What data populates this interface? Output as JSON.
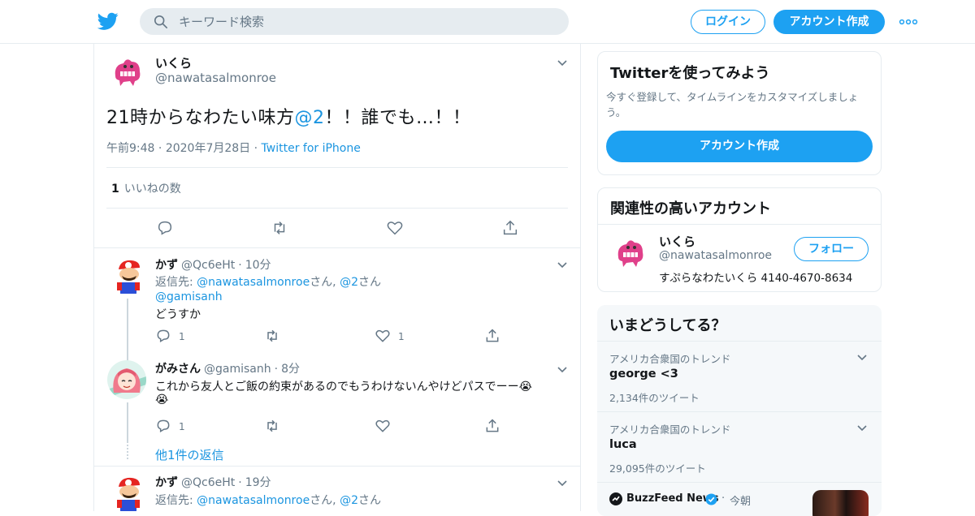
{
  "header": {
    "search_placeholder": "キーワード検索",
    "login_label": "ログイン",
    "signup_label": "アカウント作成"
  },
  "tweet": {
    "name": "いくら",
    "handle": "@nawatasalmonroe",
    "text_before": "21時からなわたい味方",
    "text_mention": "@2",
    "text_after": "！！誰でも…！！",
    "time": "午前9:48",
    "date": "2020年7月28日",
    "source": "Twitter for iPhone",
    "like_count": "1",
    "like_label": "いいねの数"
  },
  "replies": [
    {
      "name": "かず",
      "handle": "@Qc6eHt",
      "time": "10分",
      "reply_to_prefix": "返信先: ",
      "reply_to_user1": "@nawatasalmonroe",
      "reply_to_mid": "さん, ",
      "reply_to_user2": "@2",
      "reply_to_suffix": "さん",
      "mention": "@gamisanh",
      "text": "どうすか",
      "reply_count": "1",
      "like_count": "1"
    },
    {
      "name": "がみさん",
      "handle": "@gamisanh",
      "time": "8分",
      "text": "これから友人とご飯の約束があるのでもうわけないんやけどパスでーー😭",
      "text2": "😭",
      "reply_count": "1",
      "more_replies": "他1件の返信"
    },
    {
      "name": "かず",
      "handle": "@Qc6eHt",
      "time": "19分",
      "reply_to_prefix": "返信先: ",
      "reply_to_user1": "@nawatasalmonroe",
      "reply_to_mid": "さん, ",
      "reply_to_user2": "@2",
      "reply_to_suffix": "さん"
    }
  ],
  "sidebar": {
    "signup_card": {
      "title": "Twitterを使ってみよう",
      "desc1": "今すぐ登録して、タイムラインをカスタマイズしましょ",
      "desc2": "う。",
      "button": "アカウント作成"
    },
    "related": {
      "title": "関連性の高いアカウント",
      "name": "いくら",
      "handle": "@nawatasalmonroe",
      "bio": "すぷらなわたいくら 4140-4670-8634",
      "follow_label": "フォロー"
    },
    "trends": {
      "title": "いまどうしてる？",
      "items": [
        {
          "context": "アメリカ合衆国のトレンド",
          "name": "george <3",
          "count": "2,134件のツイート"
        },
        {
          "context": "アメリカ合衆国のトレンド",
          "name": "luca",
          "count": "29,095件のツイート"
        }
      ],
      "news_source": "BuzzFeed News",
      "news_time": "今朝"
    }
  },
  "colors": {
    "accent": "#1da1f2",
    "link": "#1b95e0",
    "muted": "#657786"
  }
}
